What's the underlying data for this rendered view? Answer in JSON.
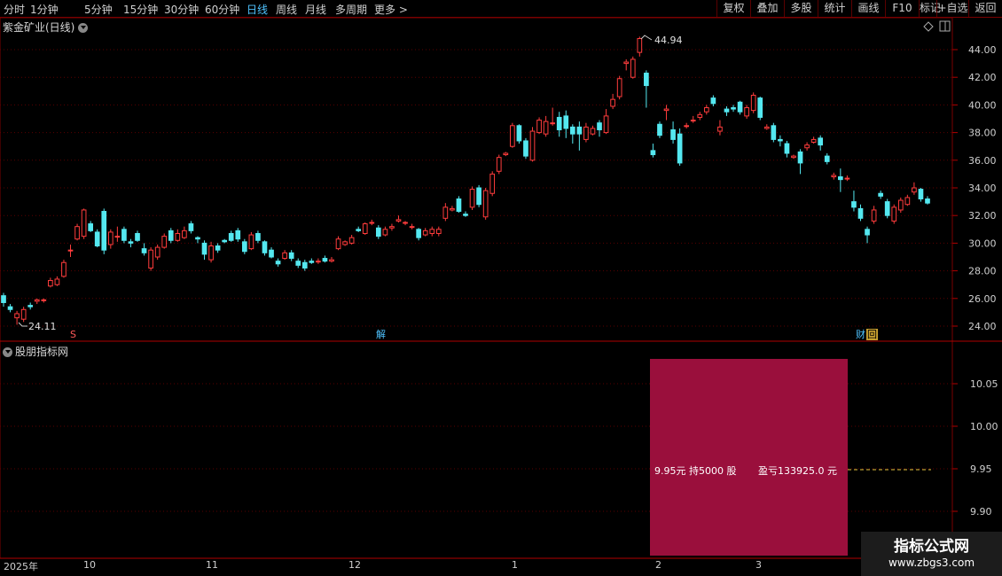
{
  "toolbar": {
    "periods": [
      "分时",
      "1分钟",
      "5分钟",
      "15分钟",
      "30分钟",
      "60分钟",
      "日线",
      "周线",
      "月线",
      "多周期",
      "更多 >"
    ],
    "active_period": "日线",
    "tools": [
      "复权",
      "叠加",
      "多股",
      "统计",
      "画线",
      "F10",
      "标记",
      "+自选",
      "返回"
    ]
  },
  "main_chart": {
    "title": "紫金矿业(日线)",
    "high_label": "44.94",
    "low_label": "24.11",
    "price_axis": [
      "44.00",
      "42.00",
      "40.00",
      "38.00",
      "36.00",
      "34.00",
      "32.00",
      "30.00",
      "28.00",
      "26.00",
      "24.00"
    ],
    "event_markers": [
      "S",
      "解",
      "财",
      "回"
    ],
    "colors": {
      "up": "#ff3c3c",
      "down": "#54e8f0",
      "grid": "#7a0000",
      "accent": "#4fc3ff"
    }
  },
  "sub_chart": {
    "title": "股朋指标网",
    "price_axis": [
      "10.05",
      "10.00",
      "9.95",
      "9.90"
    ],
    "holding_text": "9.95元 持5000 股",
    "pnl_text": "盈亏133925.0 元",
    "box_color": "#9a0f3c"
  },
  "date_axis": [
    "2025年",
    "10",
    "11",
    "12",
    "1",
    "2",
    "3"
  ],
  "watermark": {
    "brand": "指标公式网",
    "url": "www.zbgs3.com"
  },
  "chart_data": {
    "type": "candlestick",
    "title": "",
    "ylim": [
      23.5,
      45.0
    ],
    "price_ticks": [
      24,
      26,
      28,
      30,
      32,
      34,
      36,
      38,
      40,
      42,
      44
    ],
    "candles": [
      [
        26.2,
        25.7,
        26.4,
        25.4
      ],
      [
        25.4,
        25.2,
        25.6,
        25.0
      ],
      [
        24.6,
        24.9,
        25.1,
        24.1
      ],
      [
        24.5,
        25.2,
        25.4,
        24.3
      ],
      [
        25.5,
        25.4,
        25.7,
        25.2
      ],
      [
        25.8,
        25.9,
        26.0,
        25.6
      ],
      [
        25.9,
        25.9,
        26.0,
        25.7
      ],
      [
        26.9,
        27.3,
        27.5,
        26.8
      ],
      [
        27.0,
        27.4,
        27.6,
        26.9
      ],
      [
        27.6,
        28.6,
        28.8,
        27.5
      ],
      [
        29.5,
        29.5,
        29.9,
        29.0
      ],
      [
        30.3,
        31.2,
        31.4,
        30.2
      ],
      [
        30.5,
        32.4,
        32.5,
        30.3
      ],
      [
        31.4,
        30.9,
        31.6,
        30.8
      ],
      [
        30.8,
        29.8,
        31.0,
        29.7
      ],
      [
        32.3,
        29.5,
        32.5,
        29.2
      ],
      [
        29.9,
        30.8,
        31.0,
        29.6
      ],
      [
        30.5,
        30.5,
        31.2,
        30.1
      ],
      [
        31.0,
        30.2,
        31.2,
        30.0
      ],
      [
        30.1,
        30.0,
        30.3,
        29.7
      ],
      [
        30.7,
        30.2,
        30.9,
        30.1
      ],
      [
        29.6,
        29.3,
        30.0,
        29.1
      ],
      [
        28.2,
        29.5,
        29.7,
        28.0
      ],
      [
        29.0,
        29.7,
        29.9,
        28.8
      ],
      [
        29.7,
        30.5,
        30.7,
        29.6
      ],
      [
        30.9,
        30.2,
        31.1,
        30.0
      ],
      [
        30.2,
        30.7,
        31.0,
        30.1
      ],
      [
        30.4,
        30.9,
        31.2,
        30.3
      ],
      [
        31.4,
        30.9,
        31.6,
        30.7
      ],
      [
        30.4,
        30.3,
        30.5,
        30.0
      ],
      [
        30.0,
        29.2,
        30.2,
        28.8
      ],
      [
        28.8,
        29.8,
        30.1,
        28.6
      ],
      [
        29.8,
        29.5,
        30.0,
        29.3
      ],
      [
        30.2,
        30.1,
        30.3,
        30.0
      ],
      [
        30.7,
        30.2,
        30.9,
        30.1
      ],
      [
        30.9,
        30.3,
        31.1,
        30.1
      ],
      [
        30.1,
        29.4,
        30.3,
        29.2
      ],
      [
        29.6,
        30.6,
        30.8,
        29.5
      ],
      [
        30.7,
        30.2,
        30.9,
        30.0
      ],
      [
        30.1,
        29.3,
        30.2,
        29.1
      ],
      [
        29.5,
        29.0,
        29.7,
        28.9
      ],
      [
        28.7,
        28.5,
        28.9,
        28.3
      ],
      [
        28.9,
        29.3,
        29.5,
        28.8
      ],
      [
        29.3,
        28.9,
        29.5,
        28.7
      ],
      [
        28.7,
        28.4,
        28.9,
        28.2
      ],
      [
        28.6,
        28.2,
        28.8,
        28.0
      ],
      [
        28.7,
        28.6,
        28.9,
        28.5
      ],
      [
        28.7,
        28.7,
        28.9,
        28.5
      ],
      [
        28.9,
        28.7,
        29.1,
        28.6
      ],
      [
        28.7,
        28.8,
        29.0,
        28.6
      ],
      [
        29.6,
        30.3,
        30.5,
        29.5
      ],
      [
        29.9,
        30.1,
        30.2,
        29.8
      ],
      [
        30.0,
        30.4,
        30.6,
        29.9
      ],
      [
        31.0,
        30.9,
        31.2,
        30.8
      ],
      [
        30.7,
        31.4,
        31.5,
        30.6
      ],
      [
        31.5,
        31.5,
        31.7,
        31.3
      ],
      [
        31.1,
        30.5,
        31.3,
        30.3
      ],
      [
        30.6,
        31.0,
        31.2,
        30.5
      ],
      [
        31.1,
        31.2,
        31.4,
        30.9
      ],
      [
        31.6,
        31.7,
        32.0,
        31.5
      ],
      [
        31.5,
        31.5,
        31.6,
        31.3
      ],
      [
        31.2,
        31.2,
        31.4,
        31.0
      ],
      [
        31.0,
        30.4,
        31.1,
        30.2
      ],
      [
        30.6,
        30.9,
        31.1,
        30.5
      ],
      [
        30.7,
        31.0,
        31.2,
        30.5
      ],
      [
        30.7,
        31.0,
        31.2,
        30.5
      ],
      [
        31.8,
        32.6,
        32.9,
        31.6
      ],
      [
        32.4,
        32.5,
        32.7,
        32.3
      ],
      [
        33.2,
        32.3,
        33.4,
        32.2
      ],
      [
        32.1,
        32.0,
        32.3,
        31.9
      ],
      [
        32.6,
        33.9,
        34.1,
        32.4
      ],
      [
        34.0,
        32.8,
        34.2,
        32.6
      ],
      [
        31.9,
        33.8,
        34.0,
        31.7
      ],
      [
        33.6,
        35.0,
        35.2,
        33.4
      ],
      [
        35.2,
        36.2,
        36.4,
        35.0
      ],
      [
        36.4,
        36.5,
        36.6,
        36.3
      ],
      [
        37.0,
        38.5,
        38.7,
        36.9
      ],
      [
        38.5,
        37.4,
        38.6,
        37.2
      ],
      [
        37.4,
        36.3,
        37.6,
        36.1
      ],
      [
        36.0,
        38.1,
        38.4,
        35.9
      ],
      [
        38.0,
        38.9,
        39.1,
        37.9
      ],
      [
        37.9,
        38.8,
        39.2,
        37.7
      ],
      [
        38.7,
        38.7,
        39.8,
        38.5
      ],
      [
        39.1,
        38.2,
        39.5,
        37.7
      ],
      [
        39.2,
        38.3,
        39.6,
        37.6
      ],
      [
        38.4,
        37.9,
        38.6,
        37.2
      ],
      [
        38.4,
        37.9,
        38.8,
        36.7
      ],
      [
        37.5,
        38.4,
        38.7,
        37.3
      ],
      [
        37.9,
        38.3,
        38.5,
        37.8
      ],
      [
        38.7,
        38.2,
        38.9,
        37.7
      ],
      [
        38.0,
        39.2,
        39.7,
        37.9
      ],
      [
        39.9,
        40.4,
        40.8,
        39.7
      ],
      [
        40.6,
        41.9,
        42.1,
        40.4
      ],
      [
        43.0,
        43.1,
        43.3,
        42.5
      ],
      [
        42.0,
        43.3,
        43.5,
        41.9
      ],
      [
        43.8,
        44.8,
        44.94,
        43.5
      ],
      [
        42.3,
        41.4,
        42.5,
        39.8
      ],
      [
        36.7,
        36.4,
        37.2,
        36.2
      ],
      [
        38.6,
        37.8,
        38.8,
        37.6
      ],
      [
        39.6,
        39.7,
        40.0,
        38.9
      ],
      [
        38.2,
        37.5,
        38.8,
        37.2
      ],
      [
        37.9,
        35.8,
        38.3,
        35.6
      ],
      [
        38.5,
        38.5,
        38.7,
        38.3
      ],
      [
        38.9,
        38.9,
        39.2,
        38.7
      ],
      [
        39.1,
        39.3,
        39.5,
        38.9
      ],
      [
        39.5,
        39.8,
        40.0,
        39.3
      ],
      [
        40.5,
        40.1,
        40.7,
        39.9
      ],
      [
        38.1,
        38.4,
        38.9,
        37.8
      ],
      [
        39.7,
        39.5,
        39.9,
        39.2
      ],
      [
        39.8,
        39.7,
        40.0,
        39.5
      ],
      [
        40.2,
        39.5,
        40.3,
        39.3
      ],
      [
        39.2,
        39.8,
        40.0,
        39.0
      ],
      [
        39.6,
        40.7,
        40.9,
        39.4
      ],
      [
        40.5,
        39.1,
        40.6,
        38.9
      ],
      [
        38.3,
        38.4,
        38.6,
        38.2
      ],
      [
        38.5,
        37.5,
        38.7,
        37.3
      ],
      [
        37.5,
        37.4,
        37.8,
        37.0
      ],
      [
        37.2,
        36.5,
        37.4,
        36.2
      ],
      [
        36.2,
        36.3,
        36.4,
        36.1
      ],
      [
        36.6,
        35.8,
        36.8,
        35.0
      ],
      [
        36.9,
        37.1,
        37.3,
        36.7
      ],
      [
        37.3,
        37.5,
        37.7,
        37.2
      ],
      [
        37.6,
        37.1,
        37.8,
        36.7
      ],
      [
        36.3,
        35.9,
        36.5,
        35.7
      ],
      [
        34.8,
        34.9,
        35.1,
        34.6
      ],
      [
        34.8,
        34.6,
        35.4,
        33.7
      ],
      [
        34.7,
        34.7,
        34.9,
        34.5
      ],
      [
        33.0,
        32.6,
        33.8,
        32.3
      ],
      [
        32.5,
        31.8,
        32.8,
        31.6
      ],
      [
        31.0,
        30.6,
        31.2,
        30.0
      ],
      [
        31.6,
        32.4,
        32.7,
        31.4
      ],
      [
        33.6,
        33.4,
        33.8,
        33.2
      ],
      [
        33.0,
        32.0,
        33.2,
        31.8
      ],
      [
        31.6,
        32.6,
        32.8,
        31.4
      ],
      [
        32.4,
        33.1,
        33.3,
        32.2
      ],
      [
        32.8,
        33.3,
        33.5,
        32.7
      ],
      [
        33.7,
        34.0,
        34.4,
        33.5
      ],
      [
        33.9,
        33.2,
        34.0,
        33.0
      ],
      [
        33.2,
        32.9,
        33.4,
        32.8
      ]
    ],
    "sub_axis": [
      10.05,
      10.0,
      9.95,
      9.9
    ],
    "sub_level": 9.95,
    "holding_price": 9.95,
    "holding_shares": 5000,
    "pnl": 133925.0
  }
}
